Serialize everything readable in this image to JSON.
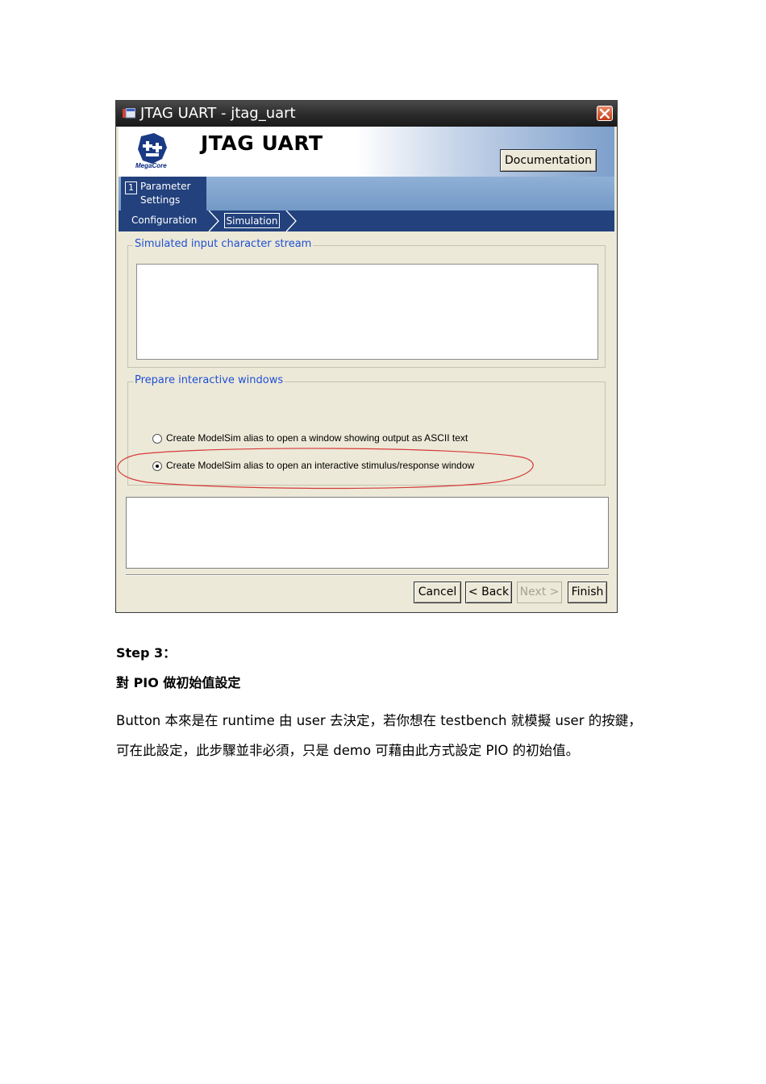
{
  "window": {
    "title": "JTAG UART - jtag_uart",
    "header_title": "JTAG UART",
    "logo_caption": "MegaCore",
    "documentation_button": "Documentation",
    "tabs": [
      {
        "number": "1",
        "label_line1": "Parameter",
        "label_line2": "Settings"
      }
    ],
    "subnav": {
      "configuration": "Configuration",
      "simulation": "Simulation"
    },
    "groups": {
      "input_stream": {
        "legend": "Simulated input character stream"
      },
      "interactive": {
        "legend": "Prepare interactive windows",
        "options": [
          {
            "label": "Create ModelSim alias to open a window showing output as ASCII text",
            "selected": false
          },
          {
            "label": "Create ModelSim alias to open an interactive stimulus/response window",
            "selected": true
          }
        ]
      }
    },
    "buttons": {
      "cancel": "Cancel",
      "back": "< Back",
      "next": "Next >",
      "finish": "Finish"
    },
    "colors": {
      "header_blue": "#22417d",
      "legend_blue": "#1f4fd4",
      "highlight_red": "#d63a3a"
    }
  },
  "document": {
    "step_heading": "Step 3：",
    "section_title": "對 PIO 做初始值設定",
    "paragraph_line1": "Button 本來是在 runtime 由 user 去決定，若你想在 testbench 就模擬 user 的按鍵，",
    "paragraph_line2": "可在此設定，此步驟並非必須，只是 demo 可藉由此方式設定 PIO 的初始值。"
  }
}
